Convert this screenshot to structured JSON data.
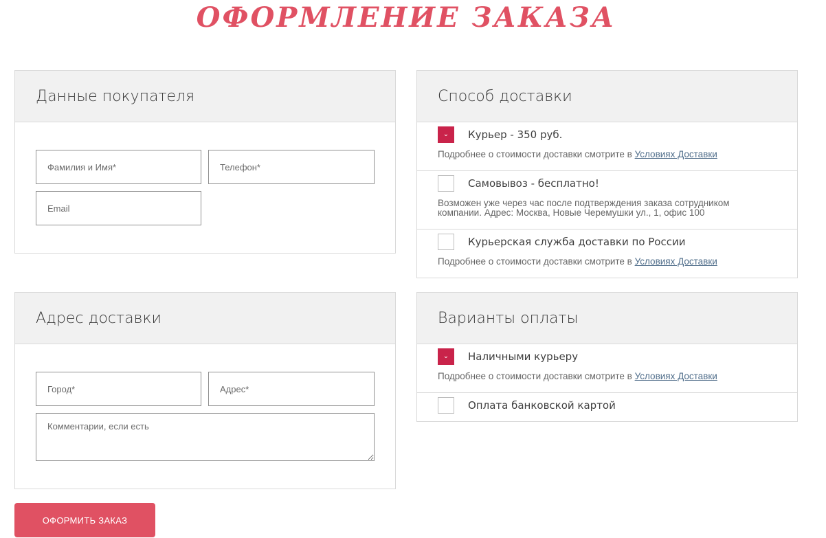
{
  "page_title": "ОФОРМЛЕНИЕ ЗАКАЗА",
  "buyer": {
    "heading": "Данные покупателя",
    "name_placeholder": "Фамилия и Имя*",
    "phone_placeholder": "Телефон*",
    "email_placeholder": "Email"
  },
  "address": {
    "heading": "Адрес доставки",
    "city_placeholder": "Город*",
    "address_placeholder": "Адрес*",
    "comment_placeholder": "Комментарии, если есть"
  },
  "delivery": {
    "heading": "Способ доставки",
    "options": [
      {
        "label": "Курьер - 350 руб.",
        "checked": true,
        "note": "Подробнее о стоимости доставки смотрите в ",
        "link": "Условиях Доставки"
      },
      {
        "label": "Самовывоз - бесплатно!",
        "checked": false,
        "note_line1": "Возможен уже через час после подтверждения заказа сотрудником",
        "note_line2": "компании. Адрес: Москва, Новые Черемушки ул., 1, офис 100"
      },
      {
        "label": "Курьерская служба доставки по России",
        "checked": false,
        "note": "Подробнее о стоимости доставки смотрите в ",
        "link": "Условиях Доставки"
      }
    ]
  },
  "payment": {
    "heading": "Варианты оплаты",
    "options": [
      {
        "label": "Наличными курьеру",
        "checked": true,
        "note": "Подробнее о стоимости доставки смотрите в ",
        "link": "Условиях Доставки"
      },
      {
        "label": "Оплата банковской картой",
        "checked": false
      }
    ]
  },
  "submit_label": "ОФОРМИТЬ ЗАКАЗ",
  "colors": {
    "accent": "#e05163",
    "checkbox": "#c9234a",
    "link": "#4f6d8a"
  }
}
